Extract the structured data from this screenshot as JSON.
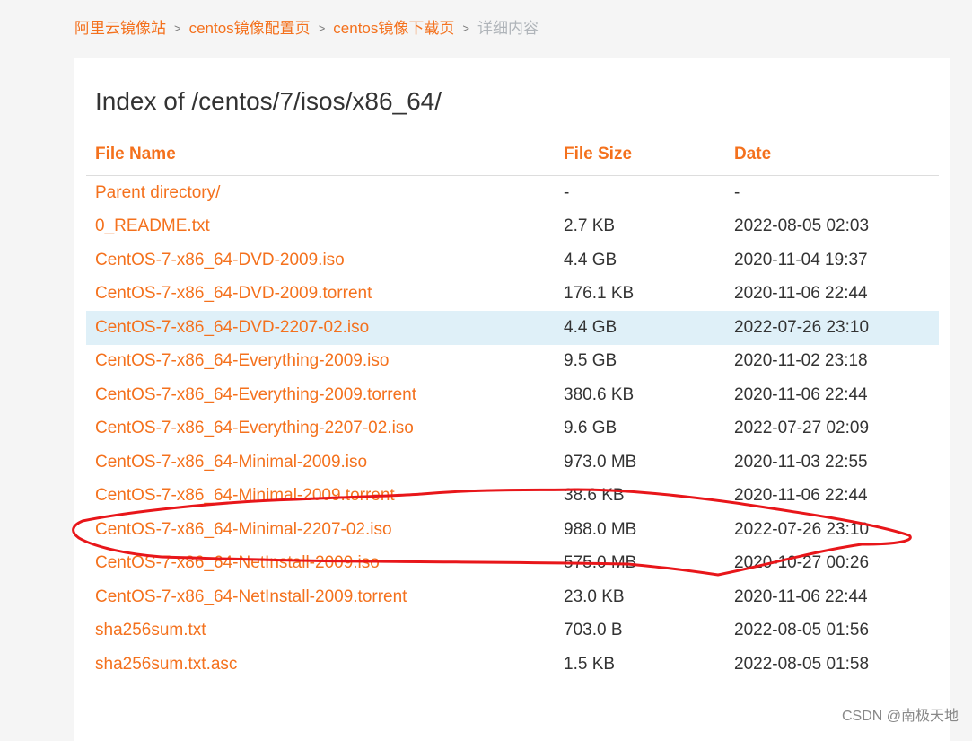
{
  "breadcrumb": {
    "items": [
      "阿里云镜像站",
      "centos镜像配置页",
      "centos镜像下载页"
    ],
    "separator": ">",
    "current": "详细内容"
  },
  "page_title": "Index of /centos/7/isos/x86_64/",
  "table": {
    "headers": [
      "File Name",
      "File Size",
      "Date"
    ],
    "rows": [
      {
        "name": "Parent directory/",
        "size": "-",
        "date": "-"
      },
      {
        "name": "0_README.txt",
        "size": "2.7 KB",
        "date": "2022-08-05 02:03"
      },
      {
        "name": "CentOS-7-x86_64-DVD-2009.iso",
        "size": "4.4 GB",
        "date": "2020-11-04 19:37"
      },
      {
        "name": "CentOS-7-x86_64-DVD-2009.torrent",
        "size": "176.1 KB",
        "date": "2020-11-06 22:44"
      },
      {
        "name": "CentOS-7-x86_64-DVD-2207-02.iso",
        "size": "4.4 GB",
        "date": "2022-07-26 23:10"
      },
      {
        "name": "CentOS-7-x86_64-Everything-2009.iso",
        "size": "9.5 GB",
        "date": "2020-11-02 23:18"
      },
      {
        "name": "CentOS-7-x86_64-Everything-2009.torrent",
        "size": "380.6 KB",
        "date": "2020-11-06 22:44"
      },
      {
        "name": "CentOS-7-x86_64-Everything-2207-02.iso",
        "size": "9.6 GB",
        "date": "2022-07-27 02:09"
      },
      {
        "name": "CentOS-7-x86_64-Minimal-2009.iso",
        "size": "973.0 MB",
        "date": "2020-11-03 22:55"
      },
      {
        "name": "CentOS-7-x86_64-Minimal-2009.torrent",
        "size": "38.6 KB",
        "date": "2020-11-06 22:44"
      },
      {
        "name": "CentOS-7-x86_64-Minimal-2207-02.iso",
        "size": "988.0 MB",
        "date": "2022-07-26 23:10"
      },
      {
        "name": "CentOS-7-x86_64-NetInstall-2009.iso",
        "size": "575.0 MB",
        "date": "2020-10-27 00:26"
      },
      {
        "name": "CentOS-7-x86_64-NetInstall-2009.torrent",
        "size": "23.0 KB",
        "date": "2020-11-06 22:44"
      },
      {
        "name": "sha256sum.txt",
        "size": "703.0 B",
        "date": "2022-08-05 01:56"
      },
      {
        "name": "sha256sum.txt.asc",
        "size": "1.5 KB",
        "date": "2022-08-05 01:58"
      }
    ]
  },
  "watermark": "CSDN @南极天地",
  "colors": {
    "accent": "#f4711d",
    "row_highlight": "#dff0f8",
    "annotation": "#e8161a"
  }
}
